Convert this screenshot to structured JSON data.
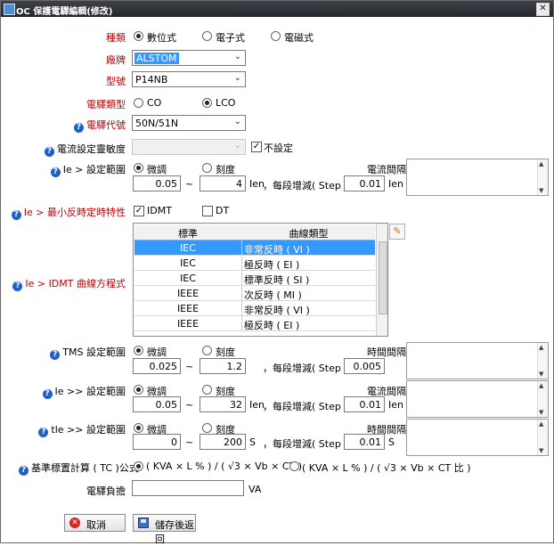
{
  "window": {
    "title": "OC 保護電驛編輯(修改)",
    "close_glyph": "✕"
  },
  "kind": {
    "label": "種類",
    "options": [
      "數位式",
      "電子式",
      "電磁式"
    ]
  },
  "brand": {
    "label": "廠牌",
    "value": "ALSTOM"
  },
  "model": {
    "label": "型號",
    "value": "P14NB"
  },
  "relay_type": {
    "label": "電驛類型",
    "options": [
      "CO",
      "LCO"
    ]
  },
  "relay_code": {
    "label": "電驛代號",
    "value": "50N/51N"
  },
  "sensitivity": {
    "label": "電流設定靈敏度",
    "checkbox_label": "不設定"
  },
  "ie_range": {
    "label": "Ie > 設定範圍",
    "mode_fine": "微調",
    "mode_scale": "刻度",
    "min": "0.05",
    "tilde": "~",
    "max": "4",
    "unit": "Ien",
    "step_label": "，每段增減( Step )",
    "step": "0.01",
    "step_unit": "Ien",
    "interval_label": "電流間隔"
  },
  "min_inverse": {
    "label": "Ie > 最小反時定時特性",
    "opt1": "IDMT",
    "opt2": "DT"
  },
  "idmt_equation": {
    "label": "Ie > IDMT 曲線方程式",
    "headers": [
      "標準",
      "曲線類型"
    ],
    "rows": [
      {
        "std": "IEC",
        "curve": "非常反時 ( VI )"
      },
      {
        "std": "IEC",
        "curve": "極反時 ( EI )"
      },
      {
        "std": "IEC",
        "curve": "標準反時 ( SI )"
      },
      {
        "std": "IEEE",
        "curve": "次反時 ( MI )"
      },
      {
        "std": "IEEE",
        "curve": "非常反時 ( VI )"
      },
      {
        "std": "IEEE",
        "curve": "極反時 ( EI )"
      }
    ]
  },
  "tms_range": {
    "label": "TMS 設定範圍",
    "mode_fine": "微調",
    "mode_scale": "刻度",
    "min": "0.025",
    "tilde": "~",
    "max": "1.2",
    "step_label": "，每段增減( Step )",
    "step": "0.005",
    "interval_label": "時間間隔"
  },
  "ie2_range": {
    "label": "Ie >> 設定範圍",
    "mode_fine": "微調",
    "mode_scale": "刻度",
    "min": "0.05",
    "tilde": "~",
    "max": "32",
    "unit": "Ien",
    "step_label": "，每段增減( Step )",
    "step": "0.01",
    "step_unit": "Ien",
    "interval_label": "電流間隔"
  },
  "tle_range": {
    "label": "tle >> 設定範圍",
    "mode_fine": "微調",
    "mode_scale": "刻度",
    "min": "0",
    "tilde": "~",
    "max": "200",
    "unit": "S",
    "step_label": "，每段增減( Step )",
    "step": "0.01",
    "step_unit": "S",
    "interval_label": "時間間隔"
  },
  "tc_formula": {
    "label": "基準標置計算 ( TC )公式",
    "opt1": "( KVA × L % ) / ( √3 × Vb × CT )",
    "opt2": "( KVA × L % ) / ( √3 × Vb × CT 比 )"
  },
  "burden": {
    "label": "電驛負擔",
    "value": "",
    "unit": "VA"
  },
  "buttons": {
    "cancel": "取消",
    "save": "儲存後返回"
  }
}
